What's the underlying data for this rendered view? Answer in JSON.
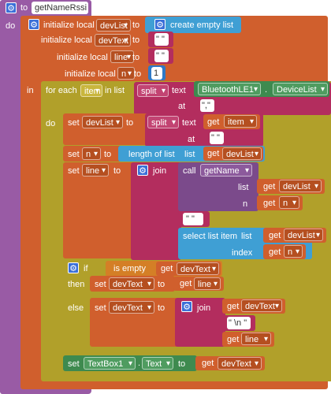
{
  "procedure": {
    "to_label": "to",
    "name": "getNameRssi",
    "do_label": "do"
  },
  "init_blocks": [
    {
      "label": "initialize local",
      "var": "devList",
      "to": "to",
      "value_kind": "create empty list",
      "value": "create empty list"
    },
    {
      "label": "initialize local",
      "var": "devText",
      "to": "to",
      "value": "\" \""
    },
    {
      "label": "initialize local",
      "var": "line",
      "to": "to",
      "value": "\" \""
    },
    {
      "label": "initialize local",
      "var": "n",
      "to": "to",
      "value": "1"
    }
  ],
  "in_label": "in",
  "foreach": {
    "label": "for each",
    "item": "item",
    "in_list": "in list",
    "split": "split",
    "text_label": "text",
    "component": "BluetoothLE1",
    "property": "DeviceList",
    "at_label": "at",
    "at_value": "\",\"",
    "do_label": "do"
  },
  "set_devlist": {
    "set": "set",
    "var": "devList",
    "to": "to",
    "split": "split",
    "text_label": "text",
    "get": "get",
    "get_var": "item",
    "at_label": "at",
    "at_value": "\" \""
  },
  "set_n": {
    "set": "set",
    "var": "n",
    "to": "to",
    "func": "length of list",
    "list_label": "list",
    "get": "get",
    "get_var": "devList"
  },
  "set_line": {
    "set": "set",
    "var": "line",
    "to": "to",
    "join": "join",
    "call": "call",
    "proc": "getName",
    "list_label": "list",
    "n_label": "n",
    "get": "get",
    "get_devlist": "devList",
    "get_n": "n",
    "sep": "\" \"",
    "select": "select list item",
    "select_list": "list",
    "index_label": "index"
  },
  "ifblock": {
    "if": "if",
    "is_empty": "is empty",
    "get": "get",
    "get_var": "devText",
    "then": "then",
    "set": "set",
    "then_var": "devText",
    "to": "to",
    "then_get": "line",
    "else": "else",
    "else_var": "devText",
    "join": "join",
    "else_get1": "devText",
    "newline": "\" \\n \"",
    "else_get2": "line"
  },
  "set_textbox": {
    "set": "set",
    "component": "TextBox1",
    "property": "Text",
    "to": "to",
    "get": "get",
    "get_var": "devText"
  },
  "colors": {
    "procedure": "#995ba5",
    "variables": "#d05f2d",
    "control": "#b1a02a",
    "text": "#b32d5e",
    "lists": "#3f9fd4",
    "components": "#3e8a4f",
    "math": "#2f79c6"
  }
}
